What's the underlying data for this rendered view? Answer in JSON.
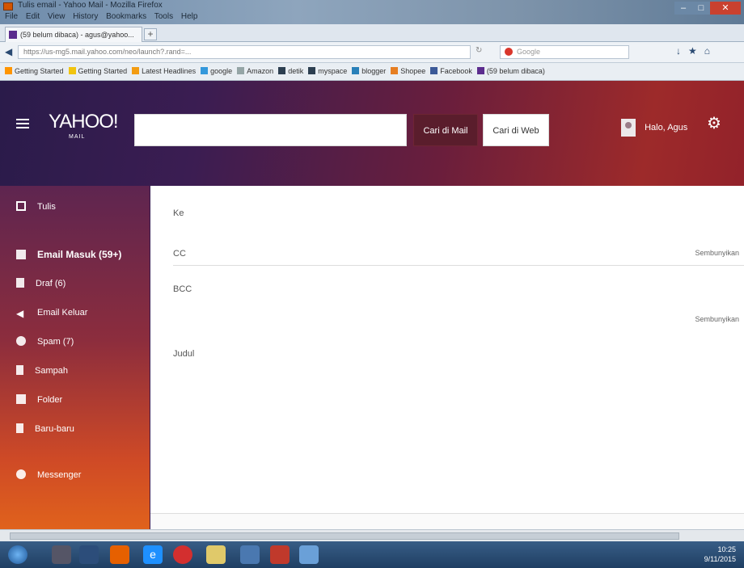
{
  "window": {
    "title": "Tulis email - Yahoo Mail - Mozilla Firefox",
    "menu": [
      "File",
      "Edit",
      "View",
      "History",
      "Bookmarks",
      "Tools",
      "Help"
    ],
    "controls": {
      "min": "–",
      "max": "□",
      "close": "✕"
    }
  },
  "tab": {
    "label": "(59 belum dibaca) - agus@yahoo...",
    "new_tab": "+"
  },
  "nav": {
    "url": "https://us-mg5.mail.yahoo.com/neo/launch?.rand=...",
    "search_placeholder": "Google",
    "icons": [
      "home-icon",
      "download-icon",
      "bookmark-icon"
    ]
  },
  "bookmarks": [
    {
      "label": "Getting Started",
      "color": "#ff9500"
    },
    {
      "label": "Getting Started",
      "color": "#f1c40f"
    },
    {
      "label": "Latest Headlines",
      "color": "#f39c12"
    },
    {
      "label": "google",
      "color": "#3498db"
    },
    {
      "label": "Amazon",
      "color": "#95a5a6"
    },
    {
      "label": "detik",
      "color": "#2c3e50"
    },
    {
      "label": "myspace",
      "color": "#2c3e50"
    },
    {
      "label": "blogger",
      "color": "#2980b9"
    },
    {
      "label": "Shopee",
      "color": "#e67e22"
    },
    {
      "label": "Facebook",
      "color": "#3b5998"
    },
    {
      "label": "(59 belum dibaca)",
      "color": "#5b2c8e"
    }
  ],
  "yahoo": {
    "logo": "YAHOO!",
    "logo_sub": "MAIL",
    "search_value": "",
    "btn_mail": "Cari di Mail",
    "btn_web": "Cari di Web",
    "user": "Halo, Agus",
    "sidebar": [
      {
        "label": "Tulis",
        "icon": "pencil-icon"
      },
      {
        "label": "Email Masuk (59+)",
        "icon": "inbox-icon"
      },
      {
        "label": "Draf (6)",
        "icon": "draft-icon"
      },
      {
        "label": "Email Keluar",
        "icon": "send-icon"
      },
      {
        "label": "Spam (7)",
        "icon": "spam-icon"
      },
      {
        "label": "Sampah",
        "icon": "trash-icon"
      },
      {
        "label": "Folder",
        "icon": "folder-icon"
      },
      {
        "label": "Baru-baru",
        "icon": "recent-icon"
      },
      {
        "label": "Messenger",
        "icon": "messenger-icon"
      }
    ],
    "compose": {
      "to": "Ke",
      "cc": "CC",
      "bcc": "BCC",
      "subject": "Judul",
      "hide_cc": "Sembunyikan",
      "hide_bcc": "Sembunyikan"
    }
  },
  "tray": {
    "time": "10:25",
    "date": "9/11/2015"
  }
}
